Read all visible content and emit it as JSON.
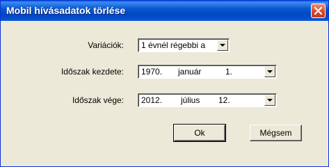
{
  "window": {
    "title": "Mobil hívásadatok törlése",
    "close_label": "✕"
  },
  "variations": {
    "label": "Variációk:",
    "value": "1 évnél régebbi a"
  },
  "start": {
    "label": "Időszak kezdete:",
    "year": "1970.",
    "month": "január",
    "day": "1."
  },
  "end": {
    "label": "Időszak vége:",
    "year": "2012.",
    "month": "július",
    "day": "12."
  },
  "buttons": {
    "ok": "Ok",
    "cancel": "Mégsem"
  }
}
